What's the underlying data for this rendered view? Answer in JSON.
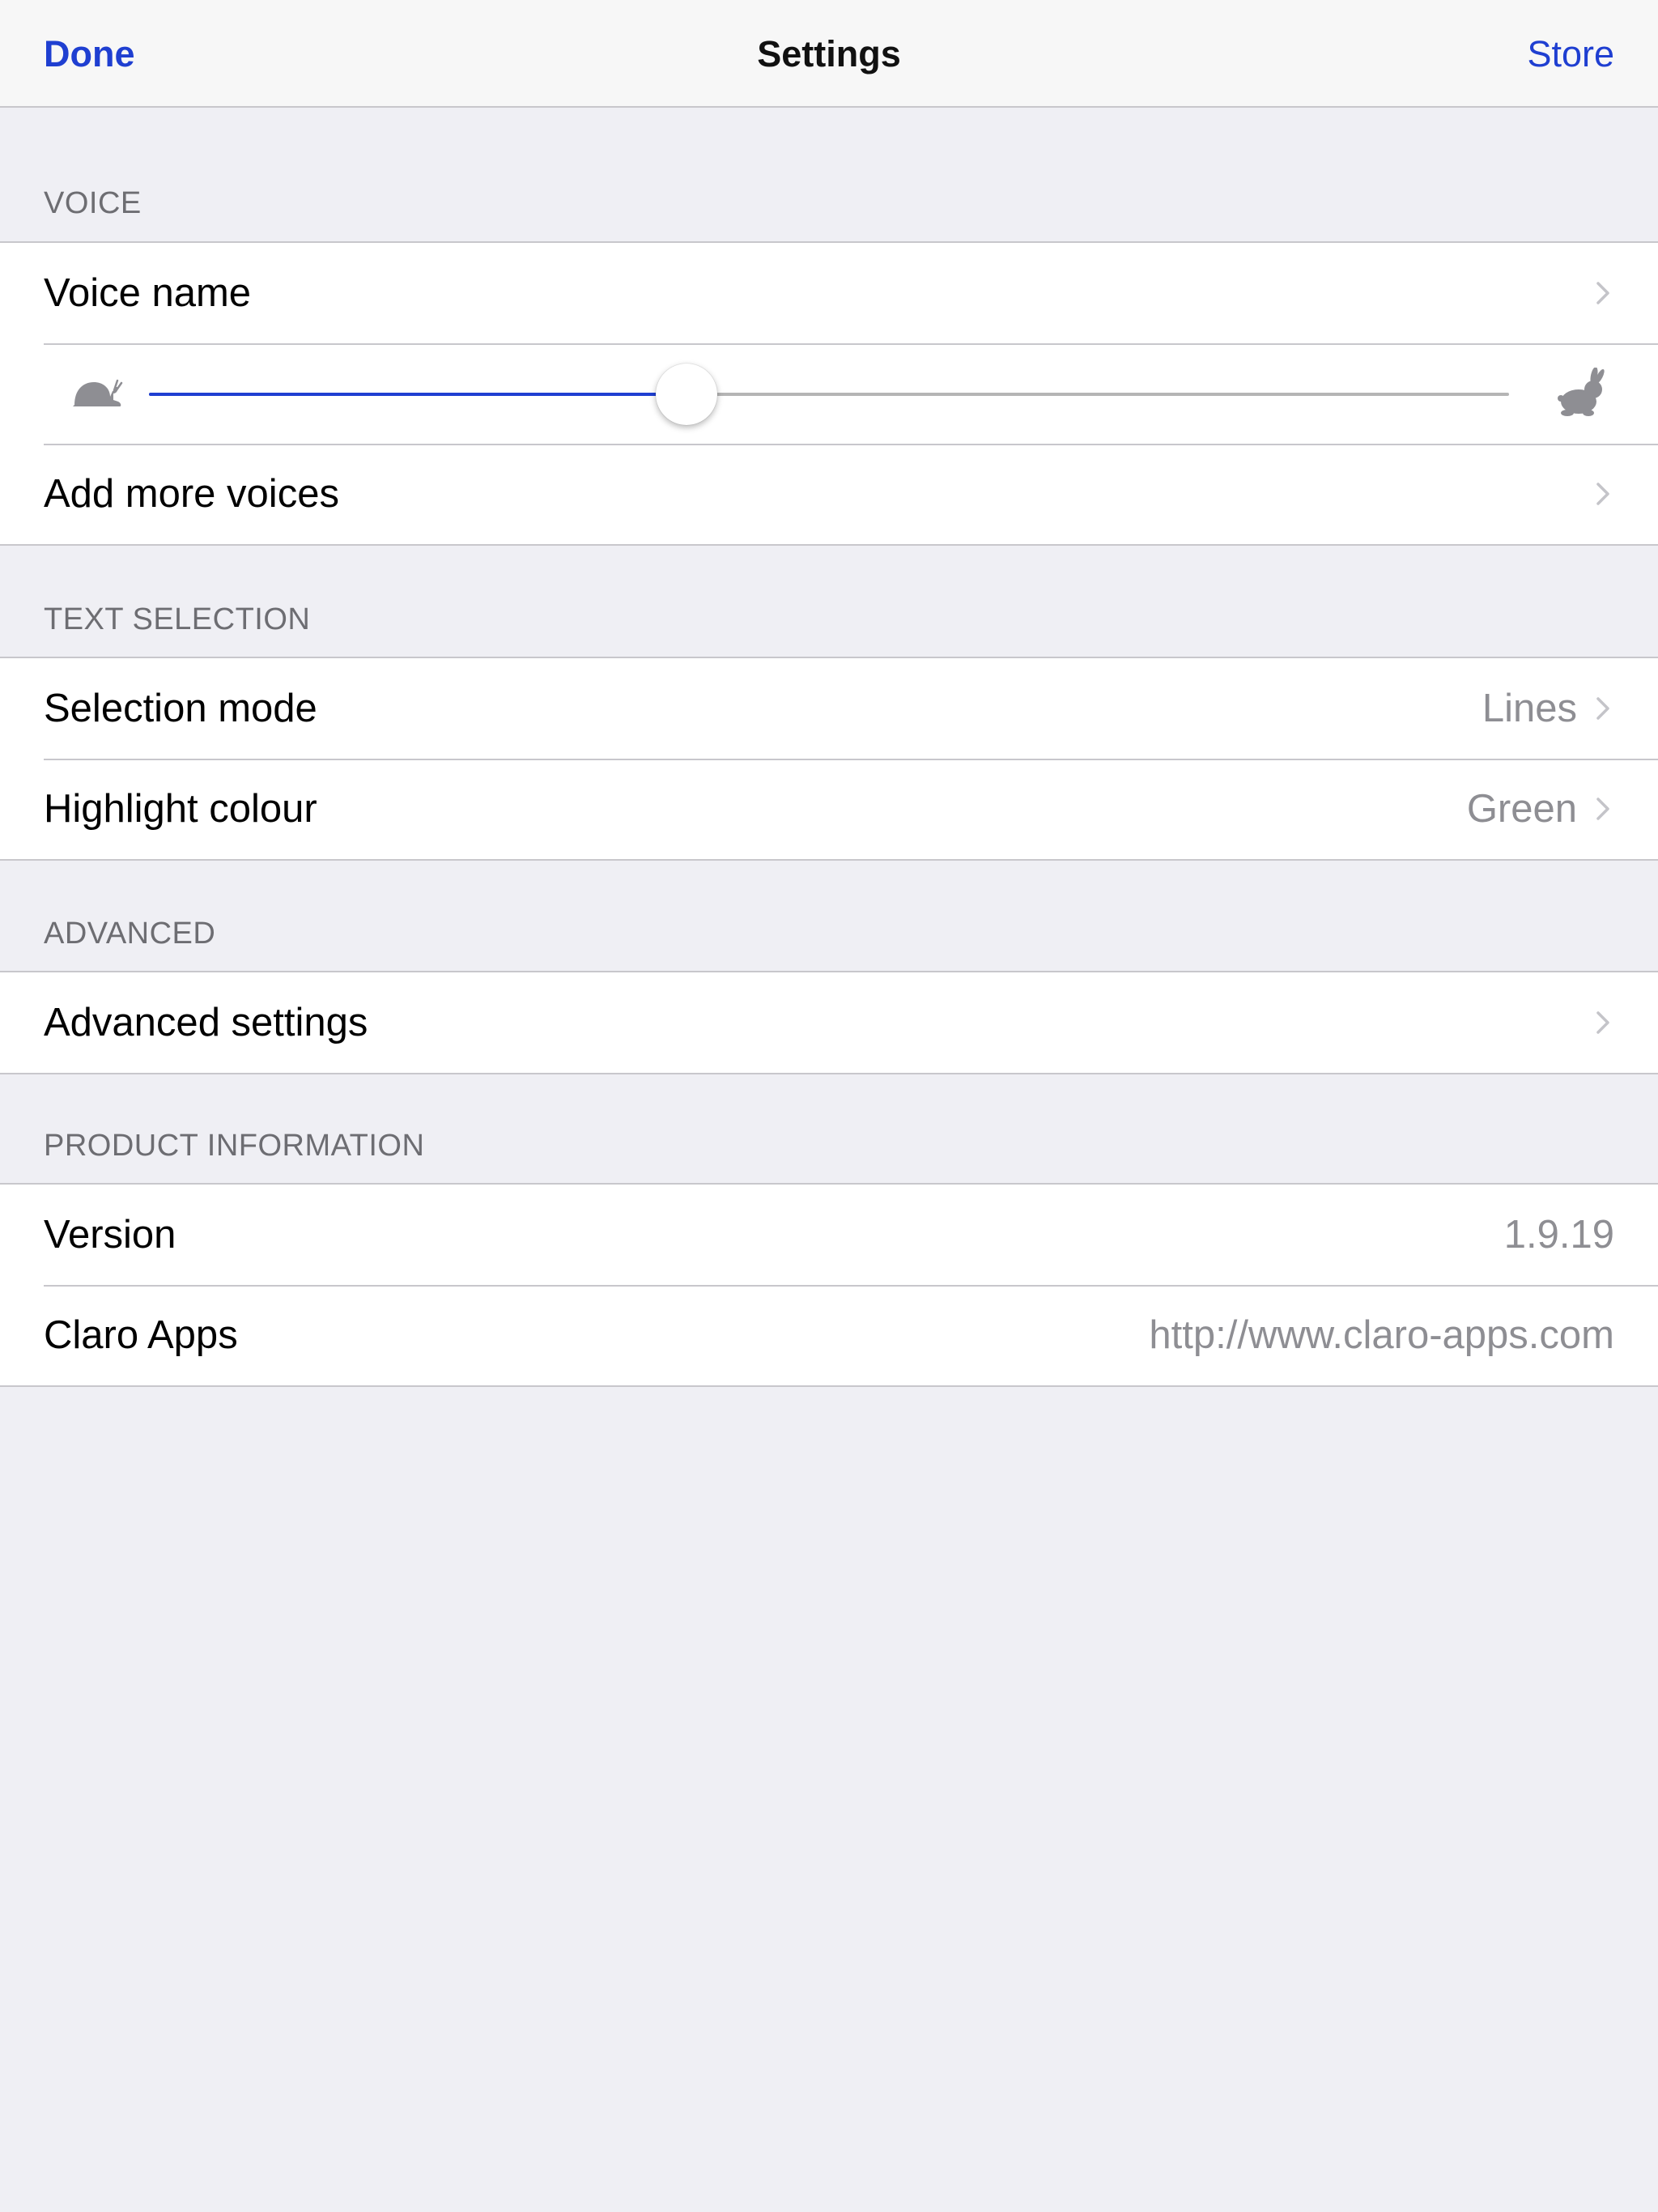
{
  "navbar": {
    "left_button": "Done",
    "title": "Settings",
    "right_button": "Store"
  },
  "colors": {
    "accent": "#1F3FD1",
    "background": "#EFEFF4",
    "secondary_text": "#8E8E93",
    "icon_gray": "#8E8E93"
  },
  "voice": {
    "header": "VOICE",
    "voice_name_label": "Voice name",
    "speed": {
      "slow_icon": "snail-icon",
      "fast_icon": "rabbit-icon",
      "value": 0.395
    },
    "add_voices_label": "Add more voices"
  },
  "text_selection": {
    "header": "TEXT SELECTION",
    "items": [
      {
        "label": "Selection mode",
        "value": "Lines"
      },
      {
        "label": "Highlight colour",
        "value": "Green"
      }
    ]
  },
  "advanced": {
    "header": "ADVANCED",
    "settings_label": "Advanced settings"
  },
  "product": {
    "header": "PRODUCT INFORMATION",
    "items": [
      {
        "label": "Version",
        "value": "1.9.19"
      },
      {
        "label": "Claro Apps",
        "value": "http://www.claro-apps.com"
      }
    ]
  }
}
